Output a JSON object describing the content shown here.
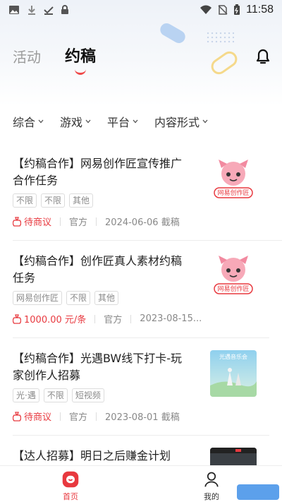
{
  "status_bar": {
    "time": "11:58"
  },
  "top_tabs": [
    {
      "label": "活动",
      "active": false
    },
    {
      "label": "约稿",
      "active": true
    }
  ],
  "filters": [
    {
      "label": "综合"
    },
    {
      "label": "游戏"
    },
    {
      "label": "平台"
    },
    {
      "label": "内容形式"
    }
  ],
  "cards": [
    {
      "title": "【约稿合作】网易创作匠宣传推广合作任务",
      "tags": [
        "不限",
        "不限",
        "其他"
      ],
      "price": "待商议",
      "source": "官方",
      "date": "2024-06-06 截稿",
      "thumb_label": "网易创作匠"
    },
    {
      "title": "【约稿合作】创作匠真人素材约稿任务",
      "tags": [
        "网易创作匠",
        "不限",
        "其他"
      ],
      "price": "1000.00 元/条",
      "source": "官方",
      "date": "2023-08-15...",
      "thumb_label": "网易创作匠"
    },
    {
      "title": "【约稿合作】光遇BW线下打卡-玩家创作人招募",
      "tags": [
        "光·遇",
        "不限",
        "短视频"
      ],
      "price": "待商议",
      "source": "官方",
      "date": "2023-08-01 截稿",
      "thumb_label": "光遇音乐会"
    },
    {
      "title": "【达人招募】明日之后赚金计划",
      "tags": [],
      "price": "",
      "source": "",
      "date": "",
      "thumb_label": ""
    }
  ],
  "bottom_nav": [
    {
      "label": "首页",
      "active": true
    },
    {
      "label": "我的",
      "active": false
    }
  ],
  "colors": {
    "accent": "#e8393f",
    "tab_active": "#111111",
    "tab_inactive": "#9a9a9a"
  }
}
